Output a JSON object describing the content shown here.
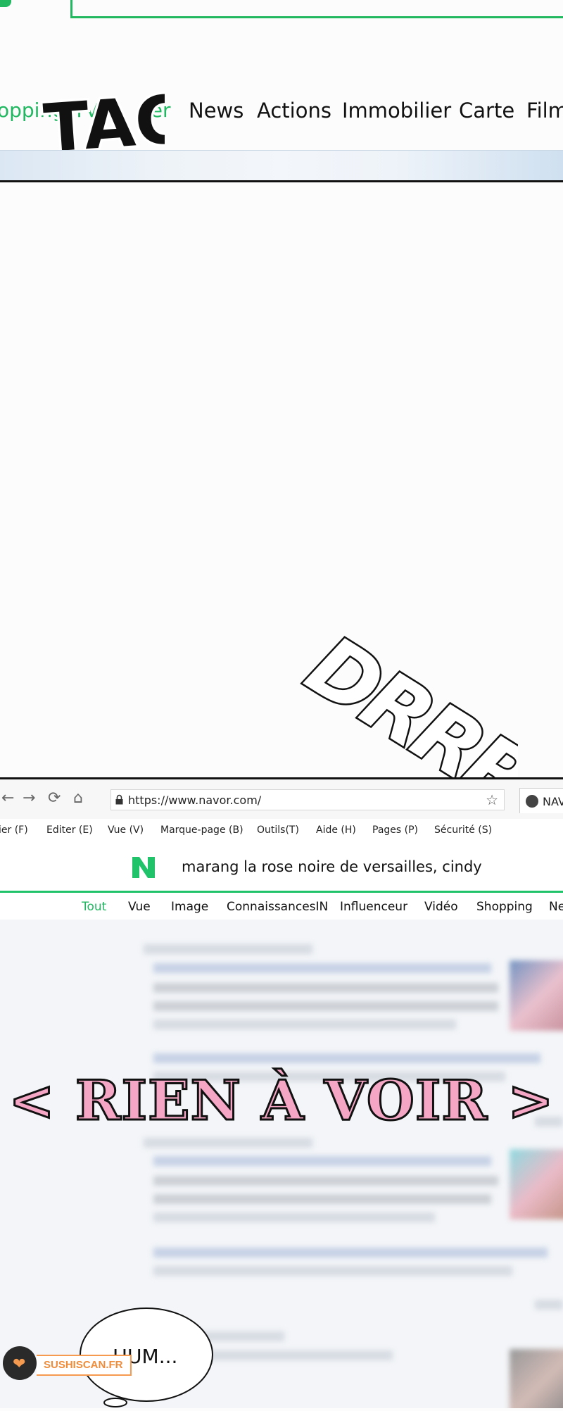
{
  "top_panel": {
    "nav_items": [
      "opping",
      "TV",
      "ger",
      "News",
      "Actions",
      "Immobilier",
      "Carte",
      "Film"
    ],
    "sfx_top": "TAC",
    "sfx_middle": "DRRR"
  },
  "browser": {
    "url": "https://www.navor.com/",
    "tab_label": "NAV",
    "menu": [
      "ier (F)",
      "Editer (E)",
      "Vue (V)",
      "Marque-page (B)",
      "Outils(T)",
      "Aide (H)",
      "Pages (P)",
      "Sécurité (S)"
    ],
    "search_query": "marang la rose noire de versailles, cindy",
    "search_tabs": [
      "Tout",
      "Vue",
      "Image",
      "ConnaissancesIN",
      "Influenceur",
      "Vidéo",
      "Shopping",
      "Ne"
    ],
    "active_tab": "Tout"
  },
  "caption": "< RIEN À VOIR >",
  "speech_bubble": "HUM...",
  "watermark": "SUSHISCAN.FR",
  "colors": {
    "brand_green": "#20b860",
    "caption_pink": "#f4a6c4",
    "watermark_orange": "#f59a4e"
  }
}
